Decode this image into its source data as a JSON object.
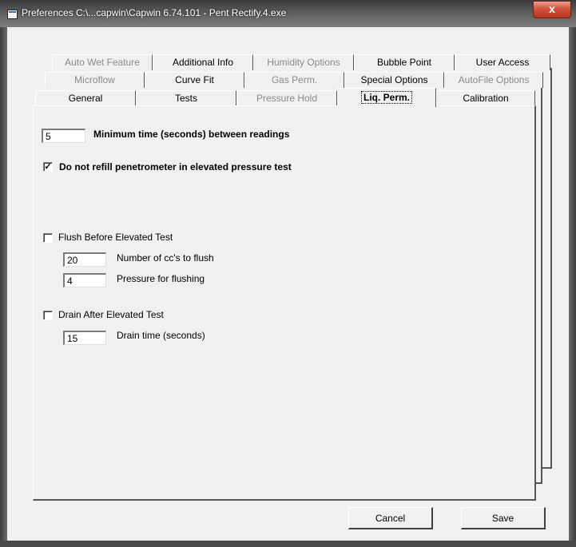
{
  "window": {
    "title": "Preferences   C:\\...capwin\\Capwin 6.74.101 - Pent Rectify.4.exe",
    "close_label": "x"
  },
  "tabs": {
    "row1": [
      "Auto Wet Feature",
      "Additional Info",
      "Humidity Options",
      "Bubble Point",
      "User Access"
    ],
    "row2": [
      "Microflow",
      "Curve Fit",
      "Gas Perm.",
      "Special Options",
      "AutoFile Options"
    ],
    "row3": [
      "General",
      "Tests",
      "Pressure Hold",
      "Liq. Perm.",
      "Calibration"
    ],
    "active": "Liq. Perm."
  },
  "liq_perm": {
    "min_time_value": "5",
    "min_time_label": "Minimum time (seconds) between readings",
    "no_refill_checked": true,
    "no_refill_label": "Do not refill penetrometer in elevated pressure test",
    "flush_checked": false,
    "flush_label": "Flush Before Elevated Test",
    "flush_cc_value": "20",
    "flush_cc_label": "Number of cc's to flush",
    "flush_pressure_value": "4",
    "flush_pressure_label": "Pressure for flushing",
    "drain_checked": false,
    "drain_label": "Drain After Elevated Test",
    "drain_time_value": "15",
    "drain_time_label": "Drain time (seconds)"
  },
  "buttons": {
    "cancel": "Cancel",
    "save": "Save"
  },
  "check_glyph": "✓"
}
